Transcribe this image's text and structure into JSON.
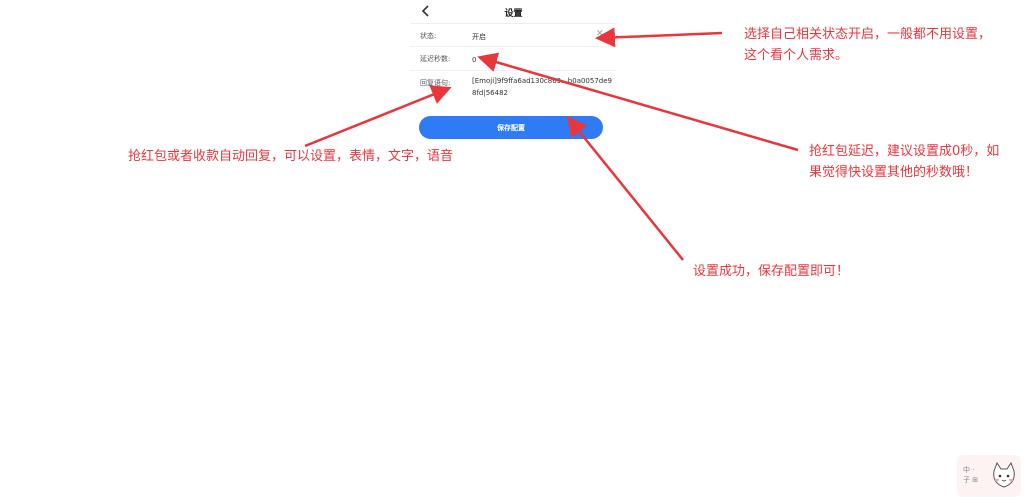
{
  "nav": {
    "title": "设置"
  },
  "settings": {
    "status": {
      "label": "状态:",
      "value": "开启"
    },
    "delay": {
      "label": "延迟秒数:",
      "value": "0"
    },
    "reply": {
      "label": "回复语句:",
      "value": "[Emoji]9f9ffa6ad130c869...b0a0057de98fd|56482"
    }
  },
  "save_button": {
    "label": "保存配置"
  },
  "annotations": {
    "status_note_line1": "选择自己相关状态开启，一般都不用设置，",
    "status_note_line2": "这个看个人需求。",
    "delay_note_line1": "抢红包延迟，建议设置成0秒，如",
    "delay_note_line2": "果觉得快设置其他的秒数哦！",
    "reply_note": "抢红包或者收款自动回复，可以设置，表情，文字，语音",
    "save_note": "设置成功，保存配置即可！"
  },
  "colors": {
    "annotation_red": "#e8363d",
    "button_blue": "#2f7bf5"
  },
  "icons": {
    "back": "chevron-left-icon",
    "clear": "close-icon"
  }
}
